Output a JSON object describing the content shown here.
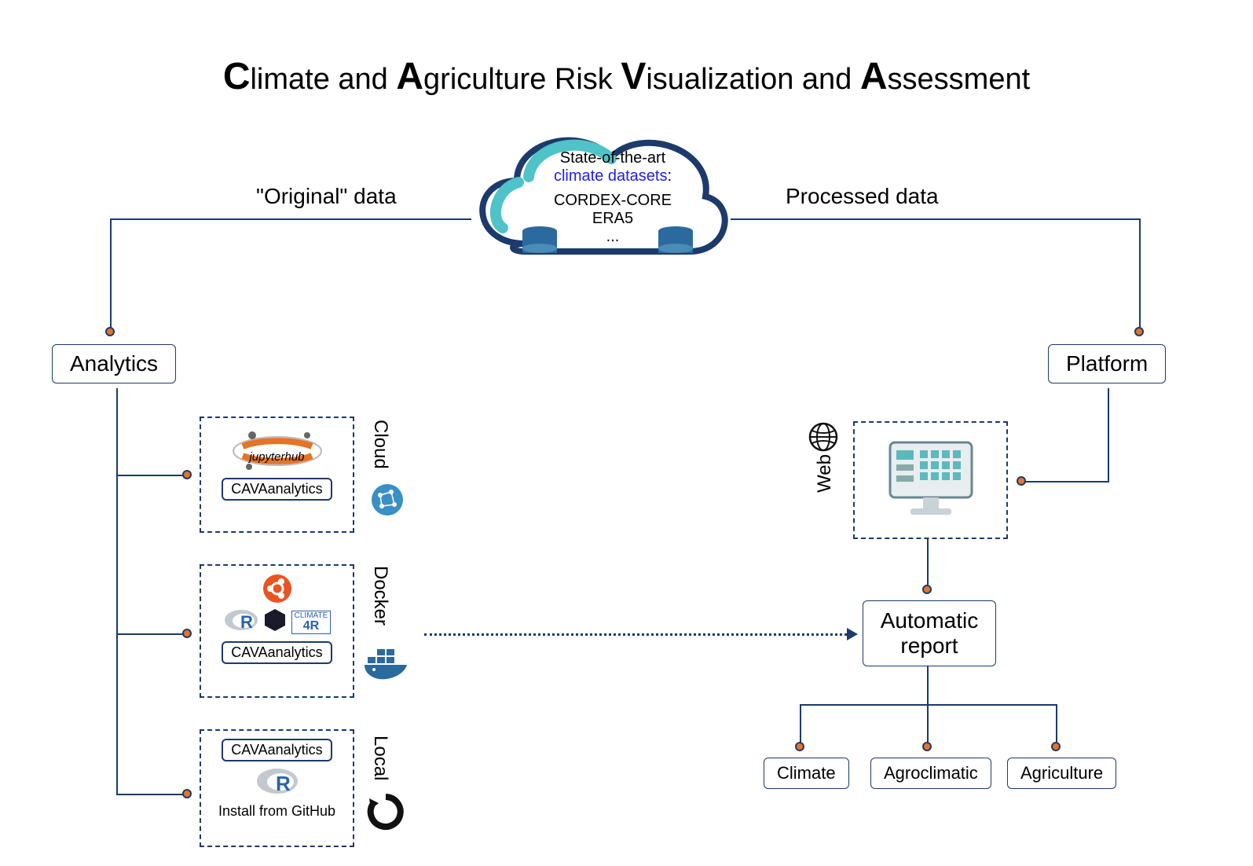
{
  "title": {
    "c": "C",
    "w1": "limate and ",
    "a": "A",
    "w2": "griculture Risk ",
    "v": "V",
    "w3": "isualization and ",
    "a2": "A",
    "w4": "ssessment"
  },
  "labels": {
    "original": "\"Original\" data",
    "processed": "Processed data"
  },
  "cloud": {
    "line1": "State-of-the-art",
    "link": "climate datasets",
    "line2": ":",
    "d1": "CORDEX-CORE",
    "d2": "ERA5",
    "d3": "..."
  },
  "boxes": {
    "analytics": "Analytics",
    "platform": "Platform",
    "autoreport1": "Automatic",
    "autoreport2": "report",
    "climate": "Climate",
    "agroclimatic": "Agroclimatic",
    "agriculture": "Agriculture"
  },
  "pills": {
    "cava": "CAVAanalytics",
    "install": "Install from GitHub"
  },
  "side": {
    "cloud": "Cloud",
    "docker": "Docker",
    "local": "Local",
    "web": "Web"
  },
  "jupyter": "jupyterhub"
}
